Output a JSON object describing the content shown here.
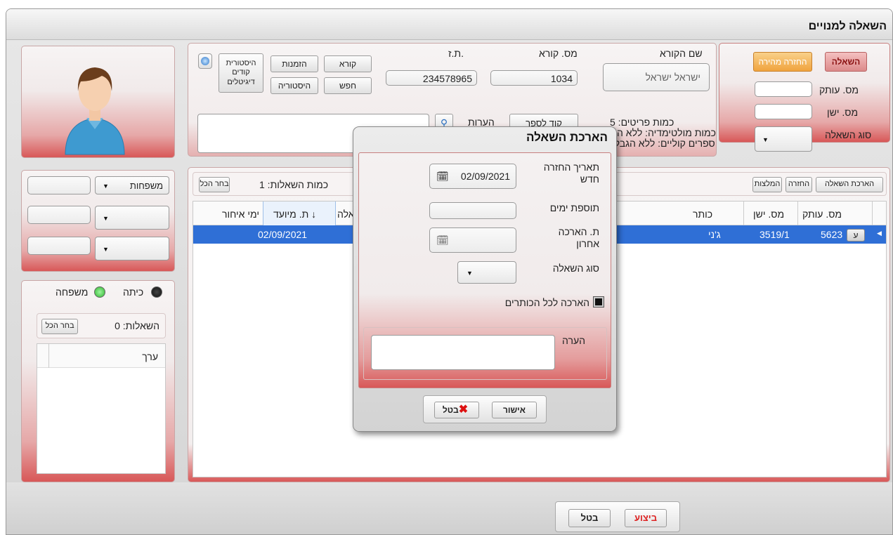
{
  "window": {
    "title": "השאלה למנויים"
  },
  "reader": {
    "name_label": "שם הקורא",
    "name_value": "ישראל ישראל",
    "number_label": "מס. קורא",
    "number_value": "1034",
    "id_label": "ת.ז.",
    "id_value": "234578965",
    "items_label": "כמות פריטים: 5",
    "multimedia_label": "כמות מולטימדיה: ללא הגבלה",
    "audio_label": "ספרים קוליים: ללא הגבלה",
    "book_code_button": "קוד לספר",
    "notes_label": "הערות"
  },
  "buttons": {
    "reader": "קורא",
    "orders": "הזמנות",
    "digital_history": "היסטורית קודים דיגיטלים",
    "search": "חפש",
    "history": "היסטוריה"
  },
  "loan_panel": {
    "tab_loan": "השאלה",
    "tab_quick_return": "החזרה מהירה",
    "copy_label": "מס. עותק",
    "old_label": "מס. ישן",
    "type_label": "סוג השאלה"
  },
  "toolbar": {
    "extend": "הארכת השאלה",
    "return": "החזרה",
    "recommend": "המלצות",
    "loans_count": "כמות השאלות: 1",
    "select_all": "בחר הכל"
  },
  "table": {
    "headers": {
      "copy": "מס. עותק",
      "old": "מס. ישן",
      "title": "כותר",
      "loan": "השאלה",
      "due": "ת. מיועד ↓",
      "late": "ימי איחור"
    },
    "rows": [
      {
        "mark": "ע",
        "copy": "5623",
        "old": "3519/1",
        "title": "ג'ני",
        "due": "02/09/2021"
      }
    ]
  },
  "left": {
    "families": "משפחות",
    "class_label": "כיתה",
    "family_label": "משפחה",
    "loans_count": "השאלות: 0",
    "select_all": "בחר הכל",
    "value_header": "ערך"
  },
  "bottom": {
    "execute": "ביצוע",
    "cancel": "בטל"
  },
  "dialog": {
    "title": "הארכת השאלה",
    "new_return_label": "תאריך החזרה חדש",
    "new_return_value": "02/09/2021",
    "add_days_label": "תוספת ימים",
    "last_extend_label": "ת. הארכה אחרון",
    "type_label": "סוג השאלה",
    "all_titles_label": "הארכה לכל הכותרים",
    "note_label": "הערה",
    "ok": "אישור",
    "cancel": "בטל"
  },
  "colors": {
    "accent_red": "#d85858",
    "selection": "#2f6fd6",
    "orange_tab": "#f3a640",
    "green_radio": "#2fb52f"
  }
}
